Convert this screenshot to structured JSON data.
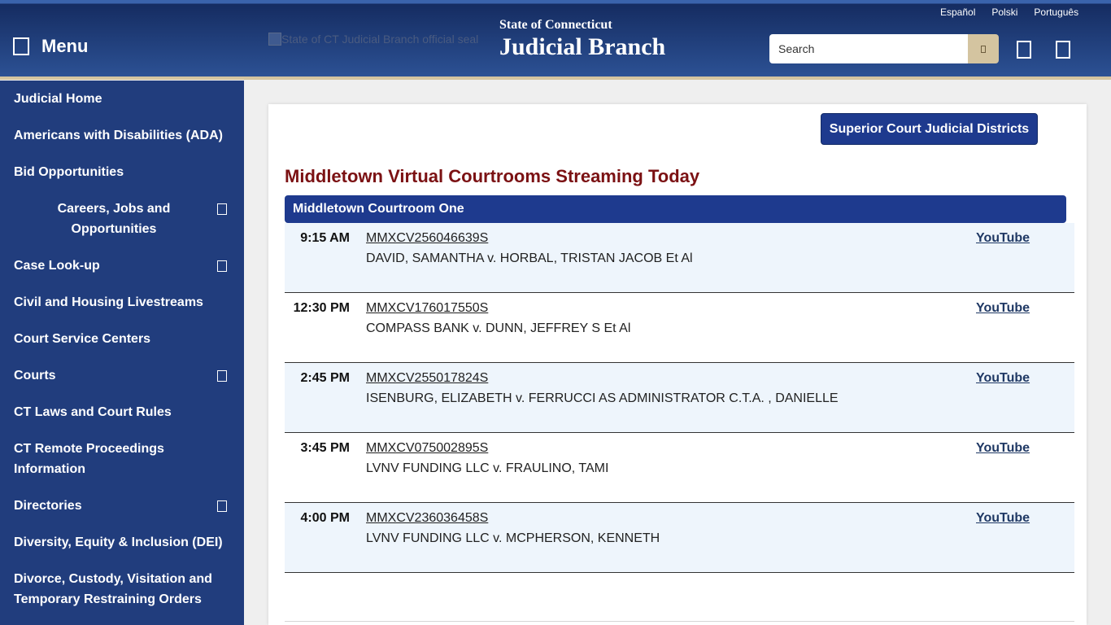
{
  "header": {
    "menu_label": "Menu",
    "seal_alt": "State of CT Judicial Branch official seal",
    "state_label": "State of Connecticut",
    "title": "Judicial Branch",
    "languages": [
      "Español",
      "Polski",
      "Português"
    ],
    "search": {
      "placeholder": "Search"
    }
  },
  "icons": {
    "menu": "menu-icon",
    "seal": "broken-image-icon",
    "search": "search-icon",
    "header_actions": [
      "blank-square-icon",
      "blank-square-icon"
    ],
    "sidebar_expand": "expand-icon"
  },
  "sidebar": {
    "items": [
      {
        "label": "Judicial Home",
        "expandable": false
      },
      {
        "label": "Americans with Disabilities (ADA)",
        "expandable": false
      },
      {
        "label": "Bid Opportunities",
        "expandable": false
      },
      {
        "label": "Careers, Jobs and Opportunities",
        "expandable": true
      },
      {
        "label": "Case Look-up",
        "expandable": true
      },
      {
        "label": "Civil and Housing Livestreams",
        "expandable": false
      },
      {
        "label": "Court Service Centers",
        "expandable": false
      },
      {
        "label": "Courts",
        "expandable": true
      },
      {
        "label": "CT Laws and Court Rules",
        "expandable": false
      },
      {
        "label": "CT Remote Proceedings Information",
        "expandable": false
      },
      {
        "label": "Directories",
        "expandable": true
      },
      {
        "label": "Diversity, Equity & Inclusion (DEI)",
        "expandable": false
      },
      {
        "label": "Divorce, Custody, Visitation and Temporary Restraining Orders",
        "expandable": false
      }
    ]
  },
  "main": {
    "districts_button": "Superior Court Judicial Districts",
    "heading": "Middletown Virtual Courtrooms Streaming Today",
    "courtroom": {
      "name": "Middletown Courtroom One",
      "sessions": [
        {
          "time": "9:15 AM",
          "case_number": "MMXCV256046639S",
          "case_name": "DAVID, SAMANTHA v. HORBAL, TRISTAN JACOB Et Al",
          "link": "YouTube"
        },
        {
          "time": "12:30 PM",
          "case_number": "MMXCV176017550S",
          "case_name": "COMPASS BANK v. DUNN, JEFFREY S Et Al",
          "link": "YouTube"
        },
        {
          "time": "2:45 PM",
          "case_number": "MMXCV255017824S",
          "case_name": "ISENBURG, ELIZABETH v. FERRUCCI AS ADMINISTRATOR C.T.A. , DANIELLE",
          "link": "YouTube"
        },
        {
          "time": "3:45 PM",
          "case_number": "MMXCV075002895S",
          "case_name": "LVNV FUNDING LLC v. FRAULINO, TAMI",
          "link": "YouTube"
        },
        {
          "time": "4:00 PM",
          "case_number": "MMXCV236036458S",
          "case_name": "LVNV FUNDING LLC v. MCPHERSON, KENNETH",
          "link": "YouTube"
        }
      ]
    }
  },
  "colors": {
    "header_top": "#3a63ab",
    "header_bottom": "#2c5194",
    "accent_tan": "#d4c4a0",
    "sidebar": "#213d7d",
    "primary": "#1e3a8e",
    "heading": "#7b1113",
    "row_alt": "#eef5fc",
    "link": "#1f3864"
  }
}
